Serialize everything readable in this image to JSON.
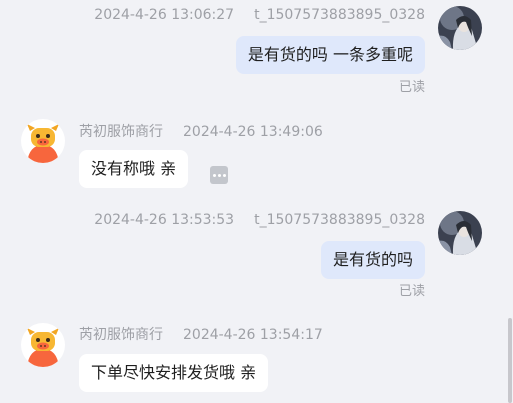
{
  "messages": [
    {
      "time": "2024-4-26 13:06:27",
      "sender": "t_1507573883895_0328",
      "text": "是有货的吗 一条多重呢",
      "status": "已读"
    },
    {
      "time": "2024-4-26 13:49:06",
      "sender": "芮初服饰商行",
      "text": "没有称哦 亲"
    },
    {
      "time": "2024-4-26 13:53:53",
      "sender": "t_1507573883895_0328",
      "text": "是有货的吗",
      "status": "已读"
    },
    {
      "time": "2024-4-26 13:54:17",
      "sender": "芮初服饰商行",
      "text": "下单尽快安排发货哦 亲"
    }
  ],
  "colors": {
    "background": "#f1f2f6",
    "my_bubble": "#dfe8fb",
    "their_bubble": "#ffffff",
    "meta_text": "#9ea0a6",
    "shop_avatar": "#f7663d"
  }
}
